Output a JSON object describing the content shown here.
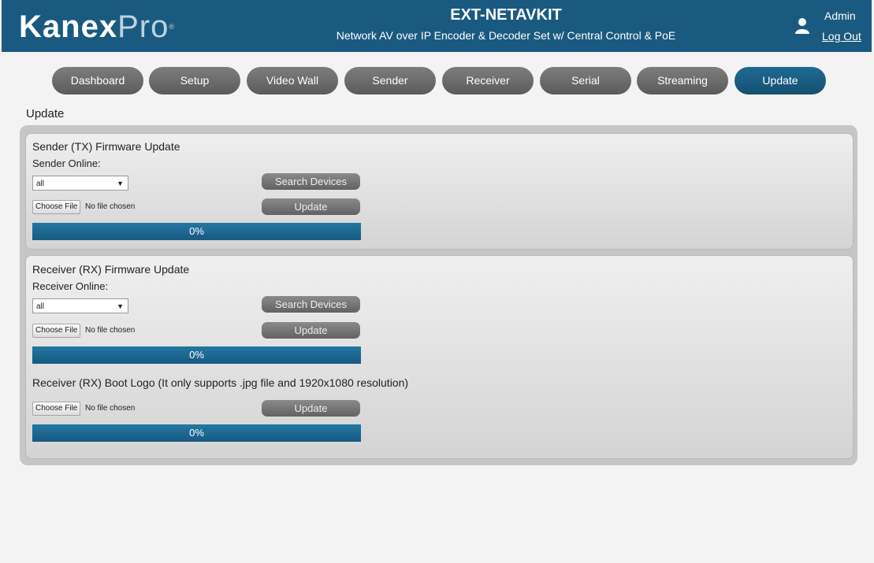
{
  "header": {
    "logo": {
      "part1": "Kanex",
      "part2": "Pro",
      "mark": "®"
    },
    "product_title": "EXT-NETAVKIT",
    "product_subtitle": "Network AV over IP Encoder & Decoder Set w/ Central Control & PoE",
    "user_name": "Admin",
    "logout_label": "Log Out",
    "user_icon": "user-icon"
  },
  "nav": {
    "tabs": [
      {
        "label": "Dashboard"
      },
      {
        "label": "Setup"
      },
      {
        "label": "Video Wall"
      },
      {
        "label": "Sender"
      },
      {
        "label": "Receiver"
      },
      {
        "label": "Serial"
      },
      {
        "label": "Streaming"
      },
      {
        "label": "Update",
        "active": true
      }
    ]
  },
  "page_title": "Update",
  "sender_section": {
    "title": "Sender (TX) Firmware Update",
    "online_label": "Sender Online:",
    "select_value": "all",
    "search_button": "Search Devices",
    "choose_file": "Choose File",
    "no_file": "No file chosen",
    "update_button": "Update",
    "progress": "0%"
  },
  "receiver_section": {
    "title": "Receiver (RX) Firmware Update",
    "online_label": "Receiver Online:",
    "select_value": "all",
    "search_button": "Search Devices",
    "choose_file": "Choose File",
    "no_file": "No file chosen",
    "update_button": "Update",
    "progress": "0%"
  },
  "boot_logo_section": {
    "title": "Receiver (RX) Boot Logo (It only supports .jpg file and 1920x1080 resolution)",
    "choose_file": "Choose File",
    "no_file": "No file chosen",
    "update_button": "Update",
    "progress": "0%"
  },
  "colors": {
    "header_bg": "#1a5a80",
    "active_tab": "#1e6a96",
    "inactive_tab": "#6c6c6c",
    "progress_bar": "#1f6d97"
  }
}
